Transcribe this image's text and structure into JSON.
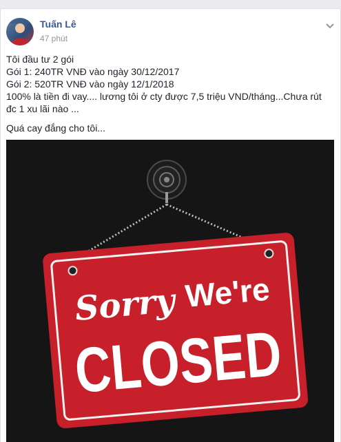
{
  "post": {
    "author": "Tuấn Lê",
    "time": "47 phút",
    "lines": [
      "Tôi đầu tư 2 gói",
      "Gói 1: 240TR VNĐ vào ngày 30/12/2017",
      "Gói 2: 520TR VNĐ vào ngày 12/1/2018",
      "100% là tiền đi vay.... lương tôi ở cty được 7,5 triệu VND/tháng...Chưa rút đc 1 xu lãi nào ..."
    ],
    "closing": "Quá cay đắng cho tôi...",
    "image": {
      "sorry": "Sorry",
      "were": "We're",
      "closed": "CLOSED"
    }
  },
  "colors": {
    "author": "#365899",
    "meta": "#90949c",
    "sign_red": "#c8202a",
    "photo_bg": "#171717"
  }
}
